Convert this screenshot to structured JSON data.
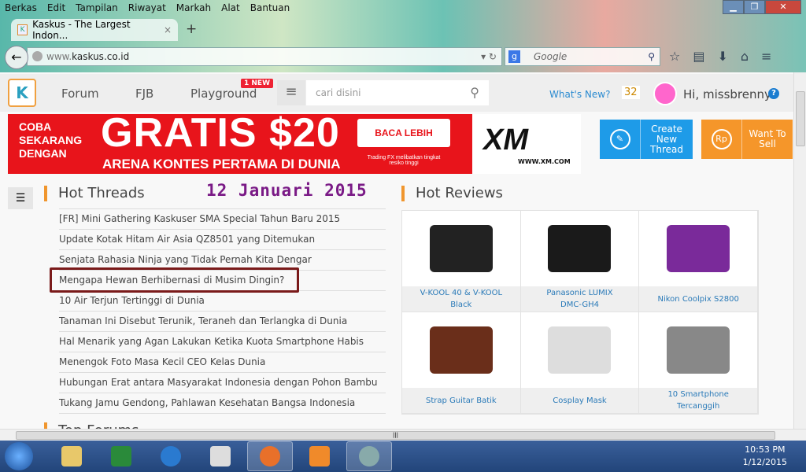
{
  "menubar": [
    "Berkas",
    "Edit",
    "Tampilan",
    "Riwayat",
    "Markah",
    "Alat",
    "Bantuan"
  ],
  "tab": {
    "title": "Kaskus - The Largest Indon...",
    "close": "×",
    "new": "+"
  },
  "address": {
    "prefix": "www.",
    "domain": "kaskus.co.id"
  },
  "search": {
    "engine": "Google",
    "placeholder": "Google"
  },
  "site": {
    "logo": "K",
    "nav": [
      "Forum",
      "FJB",
      "Playground"
    ],
    "badge": "1 NEW",
    "search_placeholder": "cari disini",
    "whats_new": "What's New?",
    "notif_count": "32",
    "greeting": "Hi, missbrenny",
    "help": "?"
  },
  "banner": {
    "left": "COBA SEKARANG DENGAN",
    "headline": "GRATIS $20",
    "sub": "ARENA KONTES PERTAMA DI DUNIA",
    "cta": "BACA LEBIH LANJUT",
    "disclaimer": "Trading FX melibatkan tingkat resiko tinggi",
    "brand": "XM",
    "brand_url": "WWW.XM.COM"
  },
  "actions": {
    "create": "Create New Thread",
    "sell": "Want To Sell",
    "sell_icon": "Rp"
  },
  "hot_threads": {
    "title": "Hot Threads",
    "date": "12 Januari 2015",
    "items": [
      "[FR] Mini Gathering Kaskuser SMA Special Tahun Baru 2015",
      "Update Kotak Hitam Air Asia QZ8501 yang Ditemukan",
      "Senjata Rahasia Ninja yang Tidak Pernah Kita Dengar",
      "Mengapa Hewan Berhibernasi di Musim Dingin?",
      "10 Air Terjun Tertinggi di Dunia",
      "Tanaman Ini Disebut Terunik, Teraneh dan Terlangka di Dunia",
      "Hal Menarik yang Agan Lakukan Ketika Kuota Smartphone Habis",
      "Menengok Foto Masa Kecil CEO Kelas Dunia",
      "Hubungan Erat antara Masyarakat Indonesia dengan Pohon Bambu",
      "Tukang Jamu Gendong, Pahlawan Kesehatan Bangsa Indonesia"
    ]
  },
  "hot_reviews": {
    "title": "Hot Reviews",
    "items": [
      {
        "label": "V-KOOL 40 & V-KOOL Black",
        "color": "#222222"
      },
      {
        "label": "Panasonic LUMIX DMC-GH4",
        "color": "#1a1a1a"
      },
      {
        "label": "Nikon Coolpix S2800",
        "color": "#7a2a9a"
      },
      {
        "label": "Strap Guitar Batik",
        "color": "#6a2e1a"
      },
      {
        "label": "Cosplay Mask",
        "color": "#dddddd"
      },
      {
        "label": "10 Smartphone Tercanggih",
        "color": "#888888"
      }
    ]
  },
  "top_forums": "Top Forums",
  "clock": {
    "time": "10:53 PM",
    "date": "1/12/2015"
  }
}
